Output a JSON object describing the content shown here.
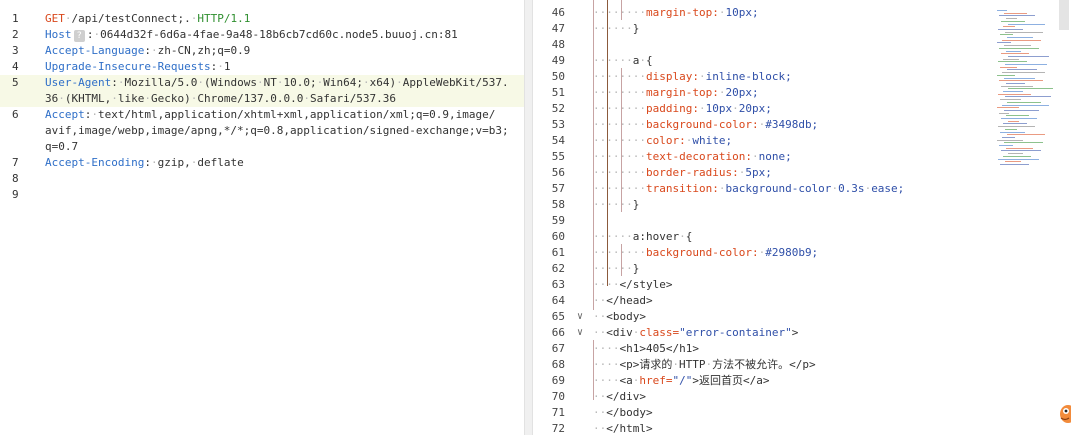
{
  "request": {
    "lines": [
      {
        "n": "1",
        "parts": [
          [
            "m",
            "GET"
          ],
          [
            "w",
            "·"
          ],
          [
            "t",
            "/api/testConnect;."
          ],
          [
            "w",
            "·"
          ],
          [
            "p",
            "HTTP/1.1"
          ]
        ]
      },
      {
        "n": "2",
        "parts": [
          [
            "k",
            "Host"
          ],
          [
            "b",
            "?"
          ],
          [
            "t",
            ":"
          ],
          [
            "w",
            "·"
          ],
          [
            "t",
            "0644d32f-6d6a-4fae-9a48-18b6cb7cd60c.node5.buuoj.cn:81"
          ]
        ]
      },
      {
        "n": "3",
        "parts": [
          [
            "k",
            "Accept-Language"
          ],
          [
            "t",
            ":"
          ],
          [
            "w",
            "·"
          ],
          [
            "t",
            "zh-CN,zh;q=0.9"
          ]
        ]
      },
      {
        "n": "4",
        "parts": [
          [
            "k",
            "Upgrade-Insecure-Requests"
          ],
          [
            "t",
            ":"
          ],
          [
            "w",
            "·"
          ],
          [
            "t",
            "1"
          ]
        ]
      },
      {
        "n": "5",
        "parts": [
          [
            "k",
            "User-Agent"
          ],
          [
            "t",
            ":"
          ],
          [
            "w",
            "·"
          ],
          [
            "t",
            "Mozilla/5.0"
          ],
          [
            "w",
            "·"
          ],
          [
            "t",
            "(Windows"
          ],
          [
            "w",
            "·"
          ],
          [
            "t",
            "NT"
          ],
          [
            "w",
            "·"
          ],
          [
            "t",
            "10.0;"
          ],
          [
            "w",
            "·"
          ],
          [
            "t",
            "Win64;"
          ],
          [
            "w",
            "·"
          ],
          [
            "t",
            "x64)"
          ],
          [
            "w",
            "·"
          ],
          [
            "t",
            "AppleWebKit/537."
          ]
        ],
        "active": true
      },
      {
        "n": "",
        "parts": [
          [
            "t",
            "36"
          ],
          [
            "w",
            "·"
          ],
          [
            "t",
            "(KHTML,"
          ],
          [
            "w",
            "·"
          ],
          [
            "t",
            "like"
          ],
          [
            "w",
            "·"
          ],
          [
            "t",
            "Gecko)"
          ],
          [
            "w",
            "·"
          ],
          [
            "t",
            "Chrome/137.0.0.0"
          ],
          [
            "w",
            "·"
          ],
          [
            "t",
            "Safari/537.36"
          ]
        ],
        "active": true
      },
      {
        "n": "6",
        "parts": [
          [
            "k",
            "Accept"
          ],
          [
            "t",
            ":"
          ],
          [
            "w",
            "·"
          ],
          [
            "t",
            "text/html,application/xhtml+xml,application/xml;q=0.9,image/"
          ]
        ]
      },
      {
        "n": "",
        "parts": [
          [
            "t",
            "avif,image/webp,image/apng,*/*;q=0.8,application/signed-exchange;v=b3;"
          ]
        ]
      },
      {
        "n": "",
        "parts": [
          [
            "t",
            "q=0.7"
          ]
        ]
      },
      {
        "n": "7",
        "parts": [
          [
            "k",
            "Accept-Encoding"
          ],
          [
            "t",
            ":"
          ],
          [
            "w",
            "·"
          ],
          [
            "t",
            "gzip,"
          ],
          [
            "w",
            "·"
          ],
          [
            "t",
            "deflate"
          ]
        ]
      },
      {
        "n": "8",
        "parts": []
      },
      {
        "n": "9",
        "parts": []
      }
    ]
  },
  "response": {
    "lines": [
      {
        "n": "46",
        "indent": "········",
        "parts": [
          [
            "cp",
            "margin-top:"
          ],
          [
            "w",
            "·"
          ],
          [
            "cv",
            "10px;"
          ]
        ]
      },
      {
        "n": "47",
        "indent": "······",
        "parts": [
          [
            "s",
            "}"
          ]
        ]
      },
      {
        "n": "48",
        "indent": "",
        "parts": []
      },
      {
        "n": "49",
        "indent": "······",
        "parts": [
          [
            "s",
            "a"
          ],
          [
            "w",
            "·"
          ],
          [
            "s",
            "{"
          ]
        ]
      },
      {
        "n": "50",
        "indent": "········",
        "parts": [
          [
            "cp",
            "display:"
          ],
          [
            "w",
            "·"
          ],
          [
            "cv",
            "inline-block;"
          ]
        ]
      },
      {
        "n": "51",
        "indent": "········",
        "parts": [
          [
            "cp",
            "margin-top:"
          ],
          [
            "w",
            "·"
          ],
          [
            "cv",
            "20px;"
          ]
        ]
      },
      {
        "n": "52",
        "indent": "········",
        "parts": [
          [
            "cp",
            "padding:"
          ],
          [
            "w",
            "·"
          ],
          [
            "cv",
            "10px"
          ],
          [
            "w",
            "·"
          ],
          [
            "cv",
            "20px;"
          ]
        ]
      },
      {
        "n": "53",
        "indent": "········",
        "parts": [
          [
            "cp",
            "background-color:"
          ],
          [
            "w",
            "·"
          ],
          [
            "cv",
            "#3498db;"
          ]
        ]
      },
      {
        "n": "54",
        "indent": "········",
        "parts": [
          [
            "cp",
            "color:"
          ],
          [
            "w",
            "·"
          ],
          [
            "cv",
            "white;"
          ]
        ]
      },
      {
        "n": "55",
        "indent": "········",
        "parts": [
          [
            "cp",
            "text-decoration:"
          ],
          [
            "w",
            "·"
          ],
          [
            "cv",
            "none;"
          ]
        ]
      },
      {
        "n": "56",
        "indent": "········",
        "parts": [
          [
            "cp",
            "border-radius:"
          ],
          [
            "w",
            "·"
          ],
          [
            "cv",
            "5px;"
          ]
        ]
      },
      {
        "n": "57",
        "indent": "········",
        "parts": [
          [
            "cp",
            "transition:"
          ],
          [
            "w",
            "·"
          ],
          [
            "cv",
            "background-color"
          ],
          [
            "w",
            "·"
          ],
          [
            "cv",
            "0.3s"
          ],
          [
            "w",
            "·"
          ],
          [
            "cv",
            "ease;"
          ]
        ]
      },
      {
        "n": "58",
        "indent": "······",
        "parts": [
          [
            "s",
            "}"
          ]
        ]
      },
      {
        "n": "59",
        "indent": "",
        "parts": []
      },
      {
        "n": "60",
        "indent": "······",
        "parts": [
          [
            "s",
            "a:hover"
          ],
          [
            "w",
            "·"
          ],
          [
            "s",
            "{"
          ]
        ]
      },
      {
        "n": "61",
        "indent": "········",
        "parts": [
          [
            "cp",
            "background-color:"
          ],
          [
            "w",
            "·"
          ],
          [
            "cv",
            "#2980b9;"
          ]
        ]
      },
      {
        "n": "62",
        "indent": "······",
        "parts": [
          [
            "s",
            "}"
          ]
        ]
      },
      {
        "n": "63",
        "indent": "····",
        "parts": [
          [
            "h",
            "</style>"
          ]
        ]
      },
      {
        "n": "64",
        "indent": "··",
        "parts": [
          [
            "h",
            "</head>"
          ]
        ]
      },
      {
        "n": "65",
        "indent": "··",
        "fold": "v",
        "parts": [
          [
            "h",
            "<body>"
          ]
        ]
      },
      {
        "n": "66",
        "indent": "··",
        "fold": "v",
        "parts": [
          [
            "h",
            "<div"
          ],
          [
            "w",
            "·"
          ],
          [
            "ha",
            "class="
          ],
          [
            "hs",
            "\"error-container\""
          ],
          [
            "h",
            ">"
          ]
        ]
      },
      {
        "n": "67",
        "indent": "····",
        "parts": [
          [
            "h",
            "<h1>405</h1>"
          ]
        ]
      },
      {
        "n": "68",
        "indent": "····",
        "parts": [
          [
            "h",
            "<p>请求的"
          ],
          [
            "w",
            "·"
          ],
          [
            "h",
            "HTTP"
          ],
          [
            "w",
            "·"
          ],
          [
            "h",
            "方法不被允许。</p>"
          ]
        ]
      },
      {
        "n": "69",
        "indent": "····",
        "parts": [
          [
            "h",
            "<a"
          ],
          [
            "w",
            "·"
          ],
          [
            "ha",
            "href="
          ],
          [
            "hs",
            "\"/\""
          ],
          [
            "h",
            ">返回首页</a>"
          ]
        ]
      },
      {
        "n": "70",
        "indent": "··",
        "parts": [
          [
            "h",
            "</div>"
          ]
        ]
      },
      {
        "n": "71",
        "indent": "··",
        "parts": [
          [
            "h",
            "</body>"
          ]
        ]
      },
      {
        "n": "72",
        "indent": "··",
        "parts": [
          [
            "h",
            "</html>"
          ]
        ]
      }
    ]
  },
  "colors": {
    "accent_orange": "#f28b3b",
    "header_name": "#2f6fc8",
    "method": "#d9481c",
    "protocol": "#2f8f2f",
    "css_value": "#2f4fa8",
    "active_line": "#f7f9e6"
  },
  "icons": {
    "hint": "hint-badge-icon",
    "fold": "fold-chevron-icon",
    "mascot": "mascot-icon"
  }
}
